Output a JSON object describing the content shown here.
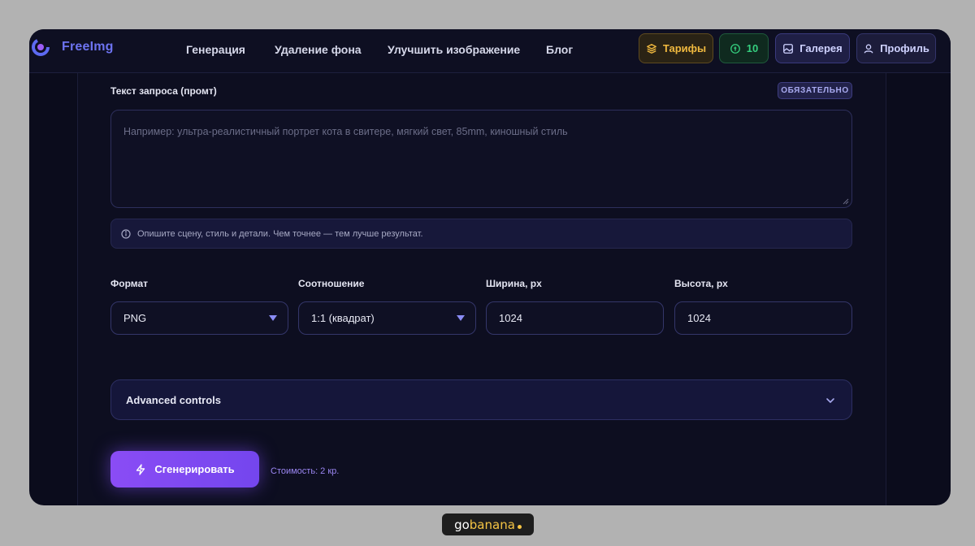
{
  "app": {
    "logo_text": "FreeImg"
  },
  "nav": {
    "links": [
      "Генерация",
      "Удаление фона",
      "Улучшить изображение",
      "Блог"
    ],
    "tariffs_label": "Тарифы",
    "credits_count": "10",
    "gallery_label": "Галерея",
    "profile_label": "Профиль"
  },
  "prompt": {
    "label": "Текст запроса (промт)",
    "required_badge": "ОБЯЗАТЕЛЬНО",
    "placeholder": "Например: ультра-реалистичный портрет кота в свитере, мягкий свет, 85mm, киношный стиль",
    "value": "",
    "hint": "Опишите сцену, стиль и детали. Чем точнее — тем лучше результат."
  },
  "settings": {
    "format": {
      "label": "Формат",
      "value": "PNG"
    },
    "ratio": {
      "label": "Соотношение",
      "value": "1:1 (квадрат)"
    },
    "width": {
      "label": "Ширина, px",
      "value": "1024"
    },
    "height": {
      "label": "Высота, px",
      "value": "1024"
    }
  },
  "advanced": {
    "label": "Advanced controls",
    "expanded": false
  },
  "generate": {
    "label": "Сгенерировать",
    "cost": "Стоимость: 2 кр."
  },
  "watermark": {
    "part1": "go",
    "part2": "banana"
  },
  "colors": {
    "accent": "#7c4af0",
    "tariffs": "#f0b93f",
    "credits": "#35d07f",
    "background": "#0b0c1c"
  },
  "icons": {
    "logo": "logo-mark-icon",
    "tariffs": "layers-icon",
    "credits": "coin-icon",
    "gallery": "image-icon",
    "profile": "user-icon",
    "hint": "info-icon",
    "select": "caret-down-icon",
    "accordion": "chevron-down-icon",
    "generate": "bolt-icon"
  }
}
